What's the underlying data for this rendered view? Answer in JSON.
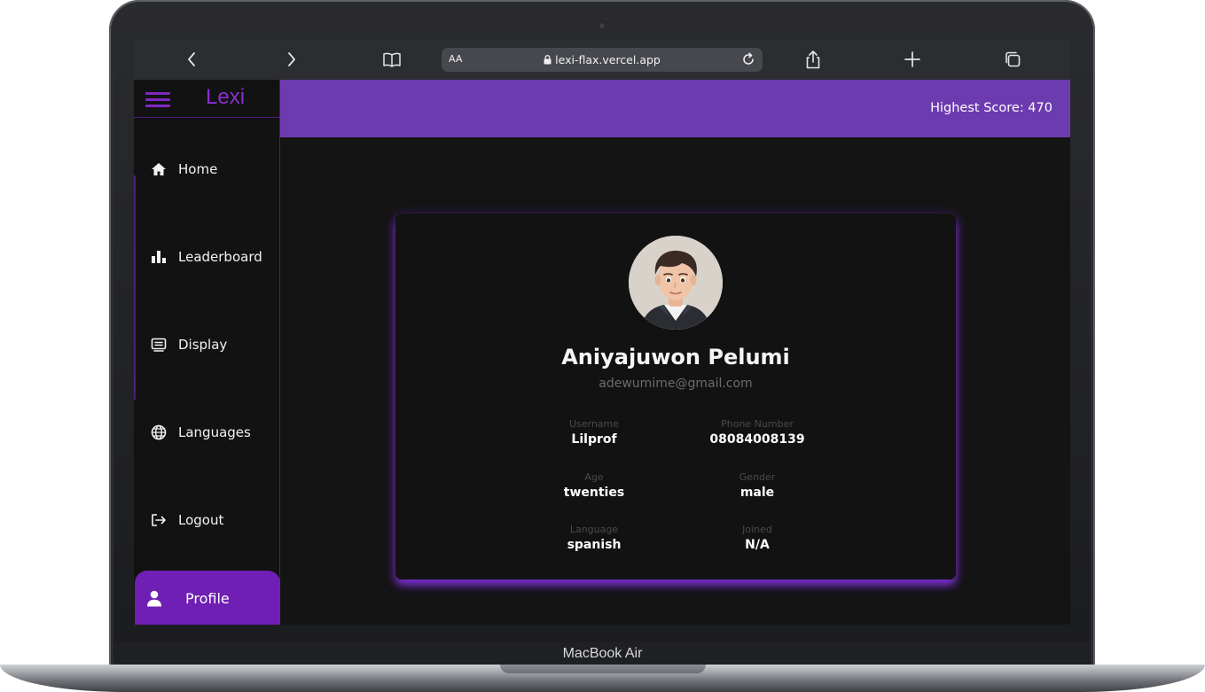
{
  "device": {
    "label": "MacBook Air"
  },
  "browser": {
    "text_size_label": "AA",
    "url": "lexi-flax.vercel.app",
    "icons": [
      "chevron-left-icon",
      "chevron-right-icon",
      "book-icon",
      "lock-icon",
      "reload-icon",
      "share-icon",
      "plus-icon",
      "tabs-icon"
    ]
  },
  "app": {
    "brand": "Lexi",
    "highest_score": "Highest Score: 470",
    "colors": {
      "accent": "#6d3bb0",
      "active": "#6f1fb3",
      "brand": "#8a2fd0",
      "background": "#141414"
    }
  },
  "sidebar": {
    "items": [
      {
        "label": "Home",
        "icon": "home-icon"
      },
      {
        "label": "Leaderboard",
        "icon": "bar-chart-icon"
      },
      {
        "label": "Display",
        "icon": "display-icon"
      },
      {
        "label": "Languages",
        "icon": "globe-icon"
      },
      {
        "label": "Logout",
        "icon": "logout-icon"
      }
    ],
    "active": {
      "label": "Profile",
      "icon": "user-icon"
    }
  },
  "profile": {
    "name": "Aniyajuwon Pelumi",
    "email": "adewumime@gmail.com",
    "fields": [
      {
        "label": "Username",
        "value": "Lilprof"
      },
      {
        "label": "Phone Number",
        "value": "08084008139"
      },
      {
        "label": "Age",
        "value": "twenties"
      },
      {
        "label": "Gender",
        "value": "male"
      },
      {
        "label": "Language",
        "value": "spanish"
      },
      {
        "label": "Joined",
        "value": "N/A"
      }
    ]
  }
}
